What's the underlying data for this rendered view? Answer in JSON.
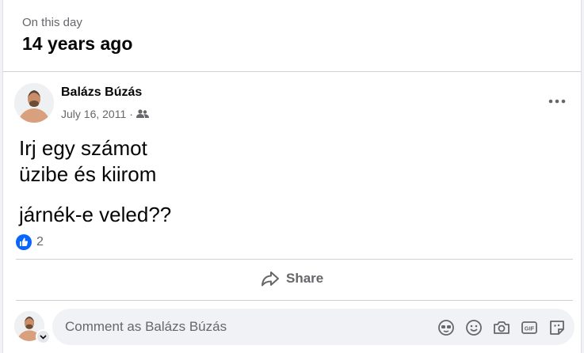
{
  "memory": {
    "caption": "On this day",
    "period": "14 years ago"
  },
  "post": {
    "author": "Balázs Búzás",
    "date": "July 16, 2011",
    "date_separator": "·",
    "audience_icon": "friends-icon",
    "lines": [
      "Irj egy számot",
      "üzibe és kiirom",
      "járnék-e veled??"
    ],
    "reaction_count": "2",
    "reaction_icon": "like-icon"
  },
  "actions": {
    "share_label": "Share"
  },
  "comment": {
    "placeholder": "Comment as Balázs Búzás",
    "icons": [
      "avatar-sticker-icon",
      "emoji-icon",
      "camera-icon",
      "gif-icon",
      "sticker-icon"
    ]
  },
  "colors": {
    "like_blue": "#0866ff",
    "muted": "#65676b",
    "divider": "#ced0d4",
    "input_bg": "#f0f2f5"
  }
}
